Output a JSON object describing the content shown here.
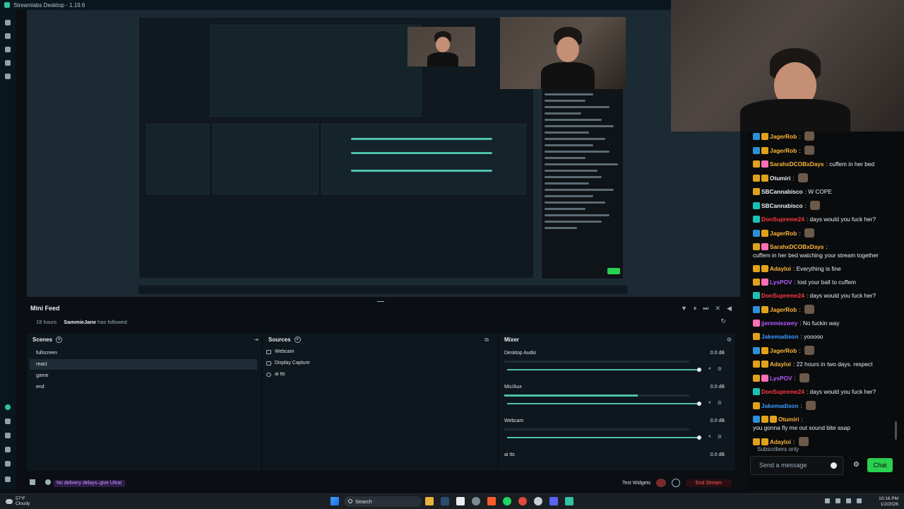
{
  "window": {
    "title": "Streamlabs Desktop - 1.19.6"
  },
  "minifeed": {
    "title": "Mini Feed",
    "time": "19 hours",
    "user": "SammieJane",
    "event": "has followed"
  },
  "scenes": {
    "title": "Scenes",
    "items": [
      "fullscreen",
      "react",
      "game",
      "end"
    ],
    "active": "react"
  },
  "sources": {
    "title": "Sources",
    "items": [
      "Webcam",
      "Display Capture",
      "ai tts"
    ]
  },
  "mixer": {
    "title": "Mixer",
    "channels": [
      {
        "name": "Desktop Audio",
        "db": "0.0 dB",
        "level": 0.0
      },
      {
        "name": "Mic/Aux",
        "db": "0.0 dB",
        "level": 0.72
      },
      {
        "name": "Webcam",
        "db": "0.0 dB",
        "level": 0.0
      },
      {
        "name": "ai tts",
        "db": "0.0 dB",
        "level": 0.0
      }
    ]
  },
  "bottombar": {
    "promo": "No delivery delays–give Ultra!",
    "test_widgets": "Test Widgets",
    "end_stream": "End Stream"
  },
  "chat": {
    "messages": [
      {
        "badges": [
          "blue",
          "gold"
        ],
        "user": "JagerRob",
        "color": "orange",
        "text": ""
      },
      {
        "badges": [
          "blue",
          "gold"
        ],
        "user": "JagerRob",
        "color": "orange",
        "text": ""
      },
      {
        "badges": [
          "gold",
          "pink"
        ],
        "user": "SarahxDCOBxDays",
        "color": "orange",
        "text": "cuffem in her bed"
      },
      {
        "badges": [
          "gold",
          "gold"
        ],
        "user": "Otumiri",
        "color": "white",
        "text": ""
      },
      {
        "badges": [
          "gold"
        ],
        "user": "SBCannabisco",
        "color": "white",
        "text": "W COPE"
      },
      {
        "badges": [
          "teal"
        ],
        "user": "SBCannabisco",
        "color": "white",
        "text": ""
      },
      {
        "badges": [
          "teal"
        ],
        "user": "DonSupreme24",
        "color": "red",
        "text": "days would you fuck her?"
      },
      {
        "badges": [
          "blue",
          "gold"
        ],
        "user": "JagerRob",
        "color": "orange",
        "text": ""
      },
      {
        "badges": [
          "gold",
          "pink"
        ],
        "user": "SarahxDCOBxDays",
        "color": "orange",
        "text": "cuffem in her bed watching your stream together"
      },
      {
        "badges": [
          "gold",
          "gold"
        ],
        "user": "Adayloi",
        "color": "orange",
        "text": "Everything is fine"
      },
      {
        "badges": [
          "gold",
          "pink"
        ],
        "user": "LysPOV",
        "color": "purple",
        "text": "lost your ball to cuffem"
      },
      {
        "badges": [
          "teal"
        ],
        "user": "DonSupreme24",
        "color": "red",
        "text": "days would you fuck her?"
      },
      {
        "badges": [
          "blue",
          "gold"
        ],
        "user": "JagerRob",
        "color": "orange",
        "text": ""
      },
      {
        "badges": [
          "pink"
        ],
        "user": "jjeremiezwey",
        "color": "purple",
        "text": "No fuckin way"
      },
      {
        "badges": [
          "gold"
        ],
        "user": "Jakemadison",
        "color": "blue",
        "text": "yooooo"
      },
      {
        "badges": [
          "blue",
          "gold"
        ],
        "user": "JagerRob",
        "color": "orange",
        "text": ""
      },
      {
        "badges": [
          "gold",
          "gold"
        ],
        "user": "Adayloi",
        "color": "orange",
        "text": "22 hours in two days. respect"
      },
      {
        "badges": [
          "gold",
          "pink"
        ],
        "user": "LysPOV",
        "color": "purple",
        "text": ""
      },
      {
        "badges": [
          "teal"
        ],
        "user": "DonSupreme24",
        "color": "red",
        "text": "days would you fuck her?"
      },
      {
        "badges": [
          "gold"
        ],
        "user": "Jakemadison",
        "color": "blue",
        "text": ""
      },
      {
        "badges": [
          "blue",
          "gold",
          "gold"
        ],
        "user": "Otumiri",
        "color": "orange",
        "text": "you gonna fly me out sound bite asap"
      },
      {
        "badges": [
          "gold",
          "gold"
        ],
        "user": "Adayloi",
        "color": "orange",
        "text": ""
      }
    ],
    "subscribers_only": "Subscribers only",
    "input_placeholder": "Send a message",
    "chat_button": "Chat"
  },
  "taskbar": {
    "temperature": "57°F",
    "weather": "Cloudy",
    "search": "Search",
    "time": "10:16 PM",
    "date": "1/2/2026"
  }
}
